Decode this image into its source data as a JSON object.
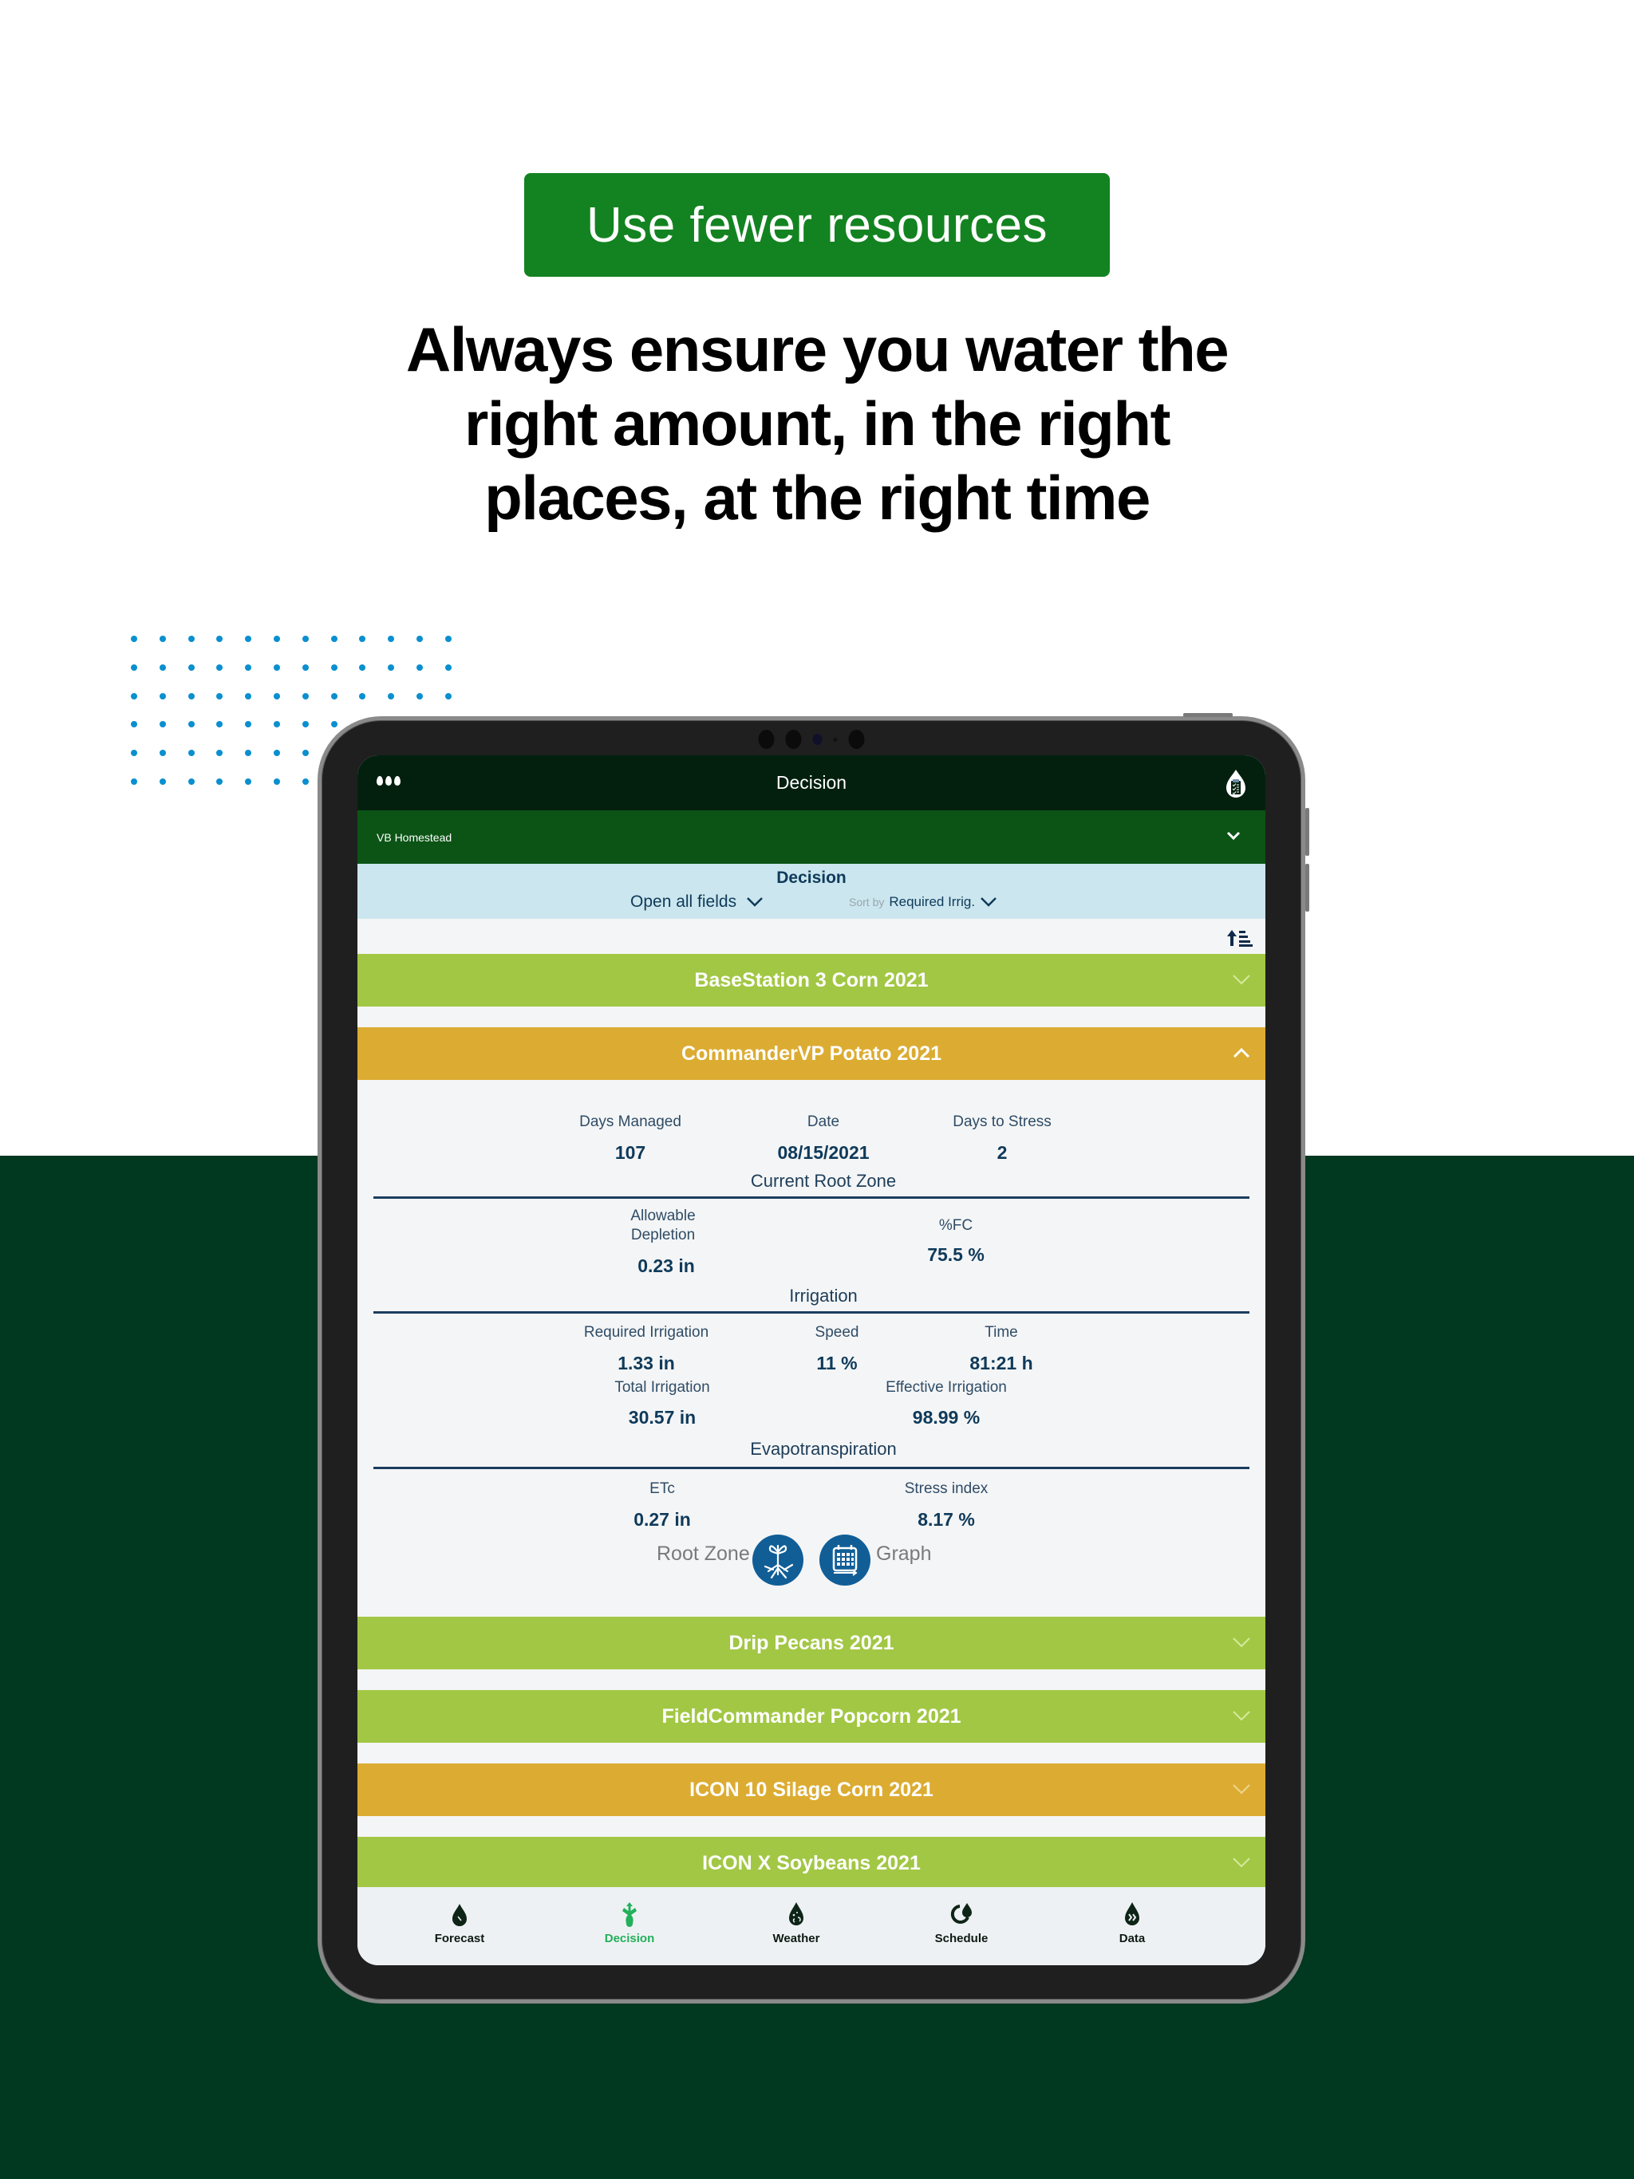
{
  "hero": {
    "badge_label": "Use fewer resources",
    "headline_lines": [
      "Always ensure you water the",
      "right amount, in the right",
      "places, at the right time"
    ]
  },
  "colors": {
    "badge_green": "#138321",
    "footer_green": "#003820",
    "dot_blue": "#0a8fcf",
    "field_green": "#a2c744",
    "field_amber": "#dcac32",
    "tab_active": "#22b05a"
  },
  "app": {
    "title": "Decision",
    "farm_selector": "VB Homestead",
    "section_title": "Decision",
    "open_all_label": "Open all fields",
    "sort_by_label": "Sort by",
    "sort_by_value": "Required Irrig.",
    "fields": [
      {
        "name": "BaseStation 3 Corn 2021",
        "status": "green",
        "expanded": false
      },
      {
        "name": "CommanderVP Potato 2021",
        "status": "amber",
        "expanded": true
      },
      {
        "name": "Drip Pecans 2021",
        "status": "green",
        "expanded": false
      },
      {
        "name": "FieldCommander Popcorn 2021",
        "status": "green",
        "expanded": false
      },
      {
        "name": "ICON 10 Silage Corn 2021",
        "status": "amber",
        "expanded": false
      },
      {
        "name": "ICON X Soybeans 2021",
        "status": "green",
        "expanded": false
      }
    ],
    "detail": {
      "days_managed_label": "Days Managed",
      "days_managed": "107",
      "date_label": "Date",
      "date": "08/15/2021",
      "days_to_stress_label": "Days to Stress",
      "days_to_stress": "2",
      "root_zone_title": "Current Root Zone",
      "allowable_depletion_label_1": "Allowable",
      "allowable_depletion_label_2": "Depletion",
      "allowable_depletion": "0.23 in",
      "fc_label": "%FC",
      "fc": "75.5 %",
      "irrigation_title": "Irrigation",
      "required_irrigation_label": "Required Irrigation",
      "required_irrigation": "1.33 in",
      "speed_label": "Speed",
      "speed": "11 %",
      "time_label": "Time",
      "time": "81:21 h",
      "total_irrigation_label": "Total Irrigation",
      "total_irrigation": "30.57 in",
      "effective_irrigation_label": "Effective Irrigation",
      "effective_irrigation": "98.99 %",
      "et_title": "Evapotranspiration",
      "etc_label": "ETc",
      "etc": "0.27 in",
      "stress_index_label": "Stress index",
      "stress_index": "8.17 %",
      "root_zone_link": "Root Zone",
      "graph_link": "Graph"
    },
    "tabs": [
      {
        "label": "Forecast",
        "icon": "forecast-drop-icon",
        "active": false
      },
      {
        "label": "Decision",
        "icon": "decision-plant-icon",
        "active": true
      },
      {
        "label": "Weather",
        "icon": "weather-drop-icon",
        "active": false
      },
      {
        "label": "Schedule",
        "icon": "schedule-cycle-icon",
        "active": false
      },
      {
        "label": "Data",
        "icon": "data-drop-icon",
        "active": false
      }
    ]
  }
}
